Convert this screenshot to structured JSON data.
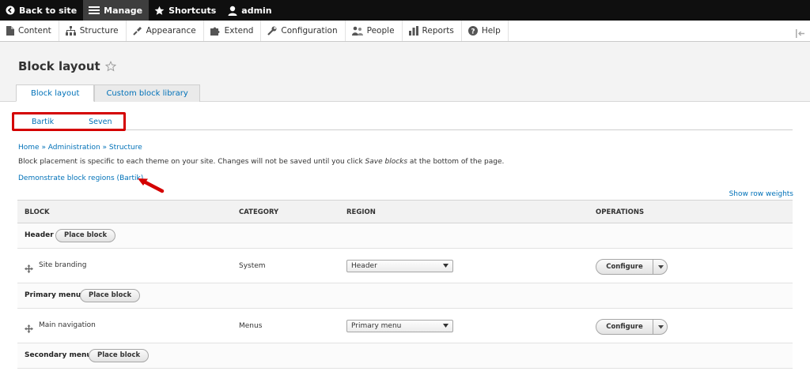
{
  "toolbar": {
    "back_label": "Back to site",
    "manage_label": "Manage",
    "shortcuts_label": "Shortcuts",
    "user_label": "admin"
  },
  "tray": {
    "items": [
      {
        "label": "Content",
        "icon": "page-icon"
      },
      {
        "label": "Structure",
        "icon": "sitemap-icon"
      },
      {
        "label": "Appearance",
        "icon": "brush-icon"
      },
      {
        "label": "Extend",
        "icon": "puzzle-icon"
      },
      {
        "label": "Configuration",
        "icon": "wrench-icon"
      },
      {
        "label": "People",
        "icon": "people-icon"
      },
      {
        "label": "Reports",
        "icon": "bar-chart-icon"
      },
      {
        "label": "Help",
        "icon": "help-icon"
      }
    ]
  },
  "page": {
    "title": "Block layout",
    "tabs": [
      "Block layout",
      "Custom block library"
    ],
    "theme_tabs": [
      "Bartik",
      "Seven"
    ],
    "breadcrumb": "Home » Administration » Structure",
    "help_before": "Block placement is specific to each theme on your site. Changes will not be saved until you click ",
    "help_em": "Save blocks",
    "help_after": " at the bottom of the page.",
    "demo_link": "Demonstrate block regions (Bartik)",
    "row_weights": "Show row weights"
  },
  "table": {
    "headers": {
      "block": "BLOCK",
      "category": "CATEGORY",
      "region": "REGION",
      "operations": "OPERATIONS"
    },
    "place_label": "Place block",
    "configure_label": "Configure",
    "regions": [
      {
        "name": "Header",
        "blocks": [
          {
            "name": "Site branding",
            "category": "System",
            "region": "Header"
          }
        ]
      },
      {
        "name": "Primary menu",
        "blocks": [
          {
            "name": "Main navigation",
            "category": "Menus",
            "region": "Primary menu"
          }
        ]
      },
      {
        "name": "Secondary menu",
        "blocks": []
      }
    ]
  },
  "colors": {
    "link": "#0071b8",
    "toolbar": "#0f0f0f",
    "highlight": "#d40000"
  }
}
